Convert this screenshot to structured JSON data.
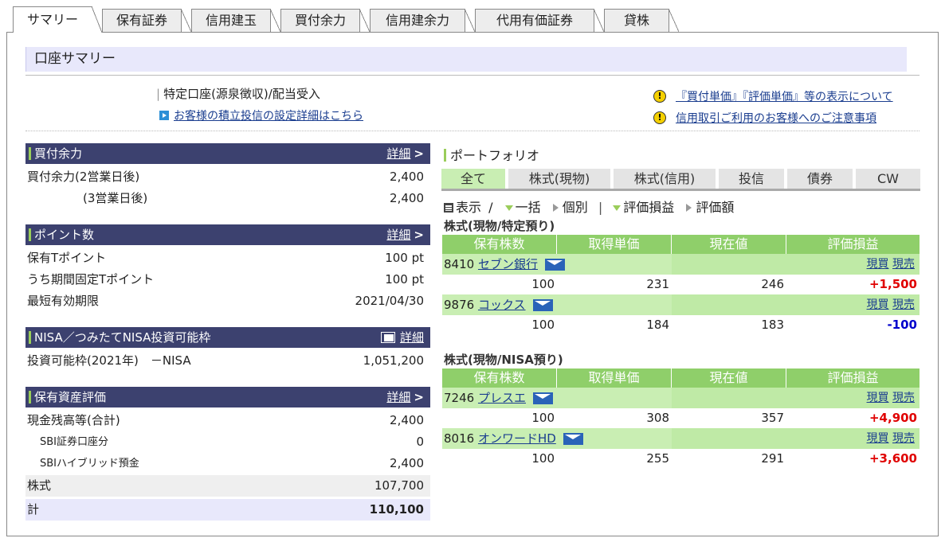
{
  "tabs": [
    "サマリー",
    "保有証券",
    "信用建玉",
    "買付余力",
    "信用建余力",
    "代用有価証券",
    "貸株"
  ],
  "title": "口座サマリー",
  "account_type": "特定口座(源泉徴収)/配当受入",
  "tsumitate_link": "お客様の積立投信の設定詳細はこちら",
  "notices": [
    "『買付単価』『評価単価』等の表示について",
    "信用取引ご利用のお客様へのご注意事項"
  ],
  "detail_label": "詳細",
  "buying_power": {
    "title": "買付余力",
    "rows": [
      {
        "label": "買付余力(2営業日後)",
        "value": "2,400"
      },
      {
        "label": "(3営業日後)",
        "value": "2,400"
      }
    ]
  },
  "points": {
    "title": "ポイント数",
    "rows": [
      {
        "label": "保有Tポイント",
        "value": "100 pt"
      },
      {
        "label": "うち期間固定Tポイント",
        "value": "100 pt"
      },
      {
        "label": "最短有効期限",
        "value": "2021/04/30"
      }
    ]
  },
  "nisa": {
    "title": "NISA／つみたてNISA投資可能枠",
    "rows": [
      {
        "label": "投資可能枠(2021年)　－NISA",
        "value": "1,051,200"
      }
    ]
  },
  "assets": {
    "title": "保有資産評価",
    "rows": [
      {
        "label": "現金残高等(合計)",
        "value": "2,400"
      },
      {
        "label": "SBI証券口座分",
        "value": "0"
      },
      {
        "label": "SBIハイブリッド預金",
        "value": "2,400"
      },
      {
        "label": "株式",
        "value": "107,700"
      },
      {
        "label": "計",
        "value": "110,100"
      }
    ]
  },
  "portfolio": {
    "title": "ポートフォリオ",
    "tabs": [
      "全て",
      "株式(現物)",
      "株式(信用)",
      "投信",
      "債券",
      "CW"
    ],
    "view": {
      "display": "表示",
      "sep": "/",
      "collapse": "一括",
      "individual": "個別",
      "pnl": "評価損益",
      "valuation": "評価額"
    },
    "columns": [
      "保有株数",
      "取得単価",
      "現在値",
      "評価損益"
    ],
    "actions": [
      "現買",
      "現売"
    ],
    "groups": [
      {
        "title": "株式(現物/特定預り)",
        "rows": [
          {
            "code": "8410",
            "name": "セブン銀行",
            "qty": "100",
            "cost": "231",
            "price": "246",
            "pnl": "+1,500",
            "sign": "pos"
          },
          {
            "code": "9876",
            "name": "コックス",
            "qty": "100",
            "cost": "184",
            "price": "183",
            "pnl": "-100",
            "sign": "neg"
          }
        ]
      },
      {
        "title": "株式(現物/NISA預り)",
        "rows": [
          {
            "code": "7246",
            "name": "プレスエ",
            "qty": "100",
            "cost": "308",
            "price": "357",
            "pnl": "+4,900",
            "sign": "pos"
          },
          {
            "code": "8016",
            "name": "オンワードHD",
            "qty": "100",
            "cost": "255",
            "price": "291",
            "pnl": "+3,600",
            "sign": "pos"
          }
        ]
      }
    ]
  }
}
